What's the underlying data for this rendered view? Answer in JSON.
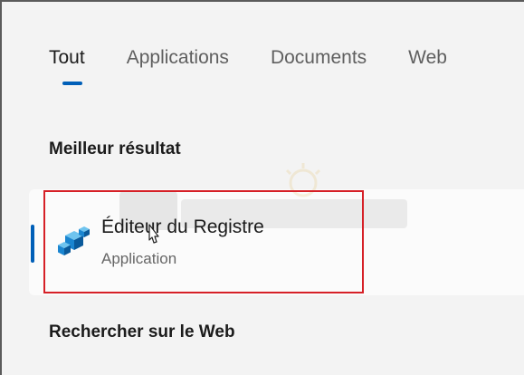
{
  "tabs": [
    {
      "label": "Tout"
    },
    {
      "label": "Applications"
    },
    {
      "label": "Documents"
    },
    {
      "label": "Web"
    }
  ],
  "best_match": {
    "section_title": "Meilleur résultat",
    "app_name": "Éditeur du Registre",
    "app_type": "Application",
    "icon": "registry-editor-icon"
  },
  "web_section": {
    "title": "Rechercher sur le Web"
  },
  "colors": {
    "accent": "#005fb8",
    "highlight": "#d62027"
  }
}
